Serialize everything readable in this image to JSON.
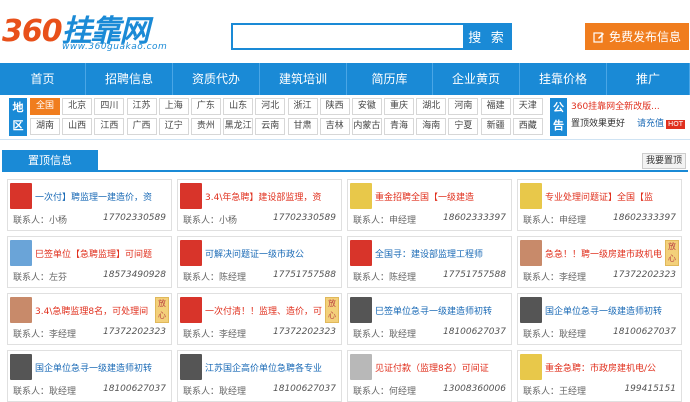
{
  "header": {
    "logo_num": "360",
    "logo_text": "挂靠网",
    "logo_url": "www.360guakao.com",
    "search_placeholder": "",
    "search_label": "搜 索",
    "publish_label": "免费发布信息"
  },
  "nav": [
    "首页",
    "招聘信息",
    "资质代办",
    "建筑培训",
    "简历库",
    "企业黄页",
    "挂靠价格",
    "推广"
  ],
  "region": {
    "tag": "地区",
    "rows": [
      [
        "全国",
        "北京",
        "四川",
        "江苏",
        "上海",
        "广东",
        "山东",
        "河北",
        "浙江",
        "陕西",
        "安徽",
        "重庆",
        "湖北",
        "河南",
        "福建",
        "天津"
      ],
      [
        "湖南",
        "山西",
        "江西",
        "广西",
        "辽宁",
        "贵州",
        "黑龙江",
        "云南",
        "甘肃",
        "吉林",
        "内蒙古",
        "青海",
        "海南",
        "宁夏",
        "新疆",
        "西藏"
      ]
    ]
  },
  "notice": {
    "tag": "公告",
    "line1_red": "360挂靠网全新改版...",
    "line2_a": "置顶效果更好",
    "line2_b": "请充值",
    "hot": "HOT"
  },
  "section": {
    "title": "置顶信息",
    "more": "我要置顶"
  },
  "colors": {
    "primary": "#1a8ad6",
    "accent": "#f07d1e",
    "red": "#e0301e"
  },
  "cards": [
    {
      "pic": "c-red",
      "pic_text": "",
      "title": "一次付】聘监理一建造价，资",
      "red": false,
      "badge": "",
      "contact": "联系人：小杨",
      "phone": "17702330589"
    },
    {
      "pic": "c-red",
      "pic_text": "",
      "title": "3.4\\年急聘】建设部监理，资",
      "red": true,
      "badge": "",
      "contact": "联系人：小杨",
      "phone": "17702330589"
    },
    {
      "pic": "c-yellow",
      "pic_text": "",
      "title": "重金招聘全国【一级建造",
      "red": true,
      "badge": "",
      "contact": "联系人：申经理",
      "phone": "18602333397"
    },
    {
      "pic": "c-yellow",
      "pic_text": "",
      "title": "专业处理问题证】全国【监",
      "red": true,
      "badge": "",
      "contact": "联系人：申经理",
      "phone": "18602333397"
    },
    {
      "pic": "c-blue",
      "pic_text": "",
      "title": "巳签单位【急聘监理】可间题",
      "red": true,
      "badge": "",
      "contact": "联系人：左芬",
      "phone": "18573490928"
    },
    {
      "pic": "c-red",
      "pic_text": "",
      "title": "可解决问题证一级市政公",
      "red": false,
      "badge": "",
      "contact": "联系人：陈经理",
      "phone": "17751757588"
    },
    {
      "pic": "c-red",
      "pic_text": "",
      "title": "全国寻：建设部监理工程师",
      "red": false,
      "badge": "",
      "contact": "联系人：陈经理",
      "phone": "17751757588"
    },
    {
      "pic": "c-face",
      "pic_text": "",
      "title": "急急！！聘一级房建市政机电",
      "red": true,
      "badge": "放心",
      "contact": "联系人：李经理",
      "phone": "17372202323"
    },
    {
      "pic": "c-face",
      "pic_text": "",
      "title": "3.4\\急聘监理8名，可处理间",
      "red": true,
      "badge": "放心",
      "contact": "联系人：李经理",
      "phone": "17372202323"
    },
    {
      "pic": "c-red",
      "pic_text": "",
      "title": "一次付清！！监理、造价，可",
      "red": true,
      "badge": "放心",
      "contact": "联系人：李经理",
      "phone": "17372202323"
    },
    {
      "pic": "c-dark",
      "pic_text": "",
      "title": "巳签单位急寻一级建造师初转",
      "red": false,
      "badge": "",
      "contact": "联系人：耿经理",
      "phone": "18100627037"
    },
    {
      "pic": "c-dark",
      "pic_text": "",
      "title": "国企单位急寻一级建造师初转",
      "red": false,
      "badge": "",
      "contact": "联系人：耿经理",
      "phone": "18100627037"
    },
    {
      "pic": "c-dark",
      "pic_text": "",
      "title": "国企单位急寻一级建造师初转",
      "red": false,
      "badge": "",
      "contact": "联系人：耿经理",
      "phone": "18100627037"
    },
    {
      "pic": "c-dark",
      "pic_text": "",
      "title": "江苏国企高价单位急聘各专业",
      "red": false,
      "badge": "",
      "contact": "联系人：耿经理",
      "phone": "18100627037"
    },
    {
      "pic": "c-gray",
      "pic_text": "",
      "title": "见证付款（监理8名）可间证",
      "red": true,
      "badge": "",
      "contact": "联系人：何经理",
      "phone": "13008360006"
    },
    {
      "pic": "c-yellow",
      "pic_text": "",
      "title": "重金急聘：市政房建机电/公",
      "red": true,
      "badge": "",
      "contact": "联系人：王经理",
      "phone": "199415151"
    }
  ],
  "card_phone_last": "13008360006"
}
